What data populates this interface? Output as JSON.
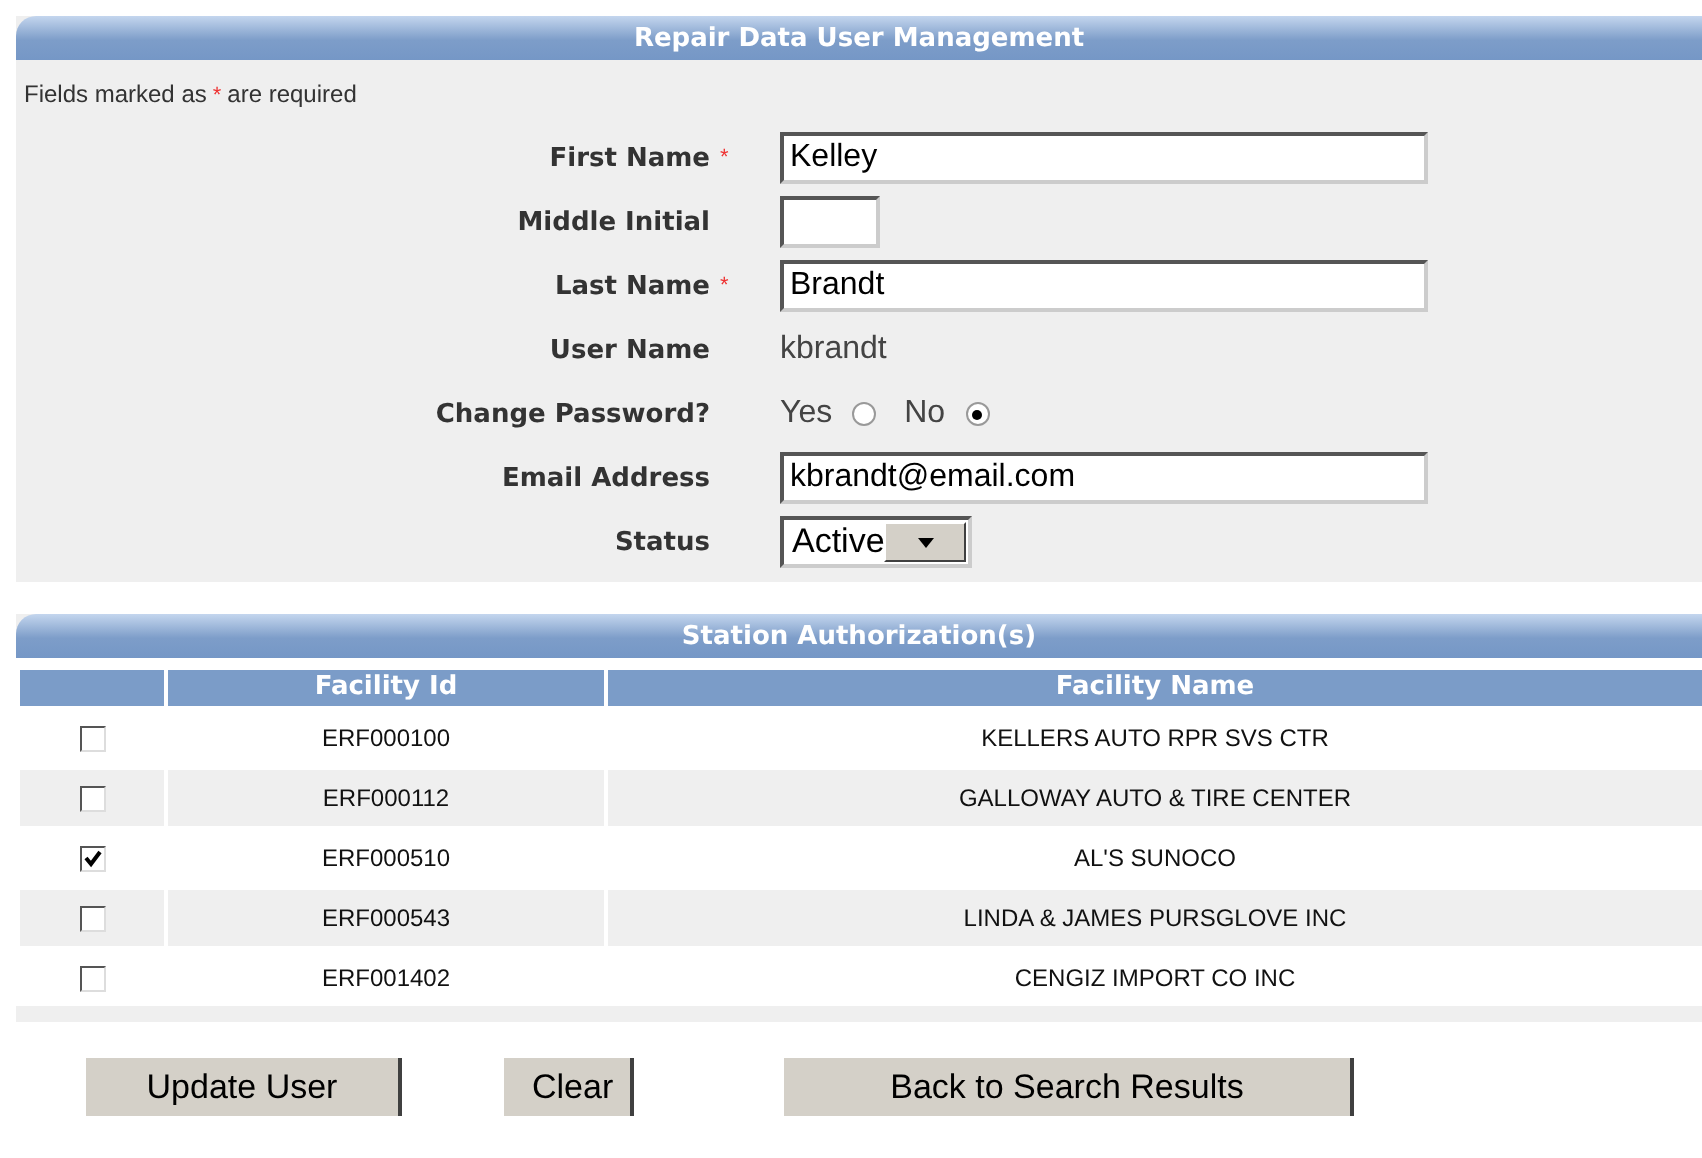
{
  "title": "Repair Data User Management",
  "required_note": {
    "before": "Fields marked as",
    "mark": "*",
    "after": "are required"
  },
  "fields": [
    {
      "kind": "text",
      "label": "First Name",
      "required": true,
      "value": "Kelley"
    },
    {
      "kind": "initial",
      "label": "Middle Initial",
      "required": false
    },
    {
      "kind": "text",
      "label": "Last Name",
      "required": true,
      "value": "Brandt"
    },
    {
      "kind": "static",
      "label": "User Name",
      "required": false,
      "value": "kbrandt"
    },
    {
      "kind": "radio",
      "label": "Change Password?",
      "required": false,
      "options": [
        {
          "label": "Yes",
          "selected": false
        },
        {
          "label": "No",
          "selected": true
        }
      ]
    },
    {
      "kind": "text",
      "label": "Email Address",
      "required": false,
      "value": "kbrandt@email.com"
    },
    {
      "kind": "select",
      "label": "Status",
      "required": false,
      "value": "Active"
    }
  ],
  "stations": {
    "title": "Station Authorization(s)",
    "columns": [
      "Facility Id",
      "Facility Name"
    ],
    "rows": [
      {
        "checked": false,
        "facility_id": "ERF000100",
        "facility_name": "KELLERS AUTO RPR SVS CTR"
      },
      {
        "checked": false,
        "facility_id": "ERF000112",
        "facility_name": "GALLOWAY AUTO & TIRE CENTER"
      },
      {
        "checked": true,
        "facility_id": "ERF000510",
        "facility_name": "AL'S SUNOCO"
      },
      {
        "checked": false,
        "facility_id": "ERF000543",
        "facility_name": "LINDA & JAMES PURSGLOVE INC"
      },
      {
        "checked": false,
        "facility_id": "ERF001402",
        "facility_name": "CENGIZ IMPORT CO INC"
      }
    ]
  },
  "buttons": [
    "Update User",
    "Clear",
    "Back to Search Results"
  ]
}
